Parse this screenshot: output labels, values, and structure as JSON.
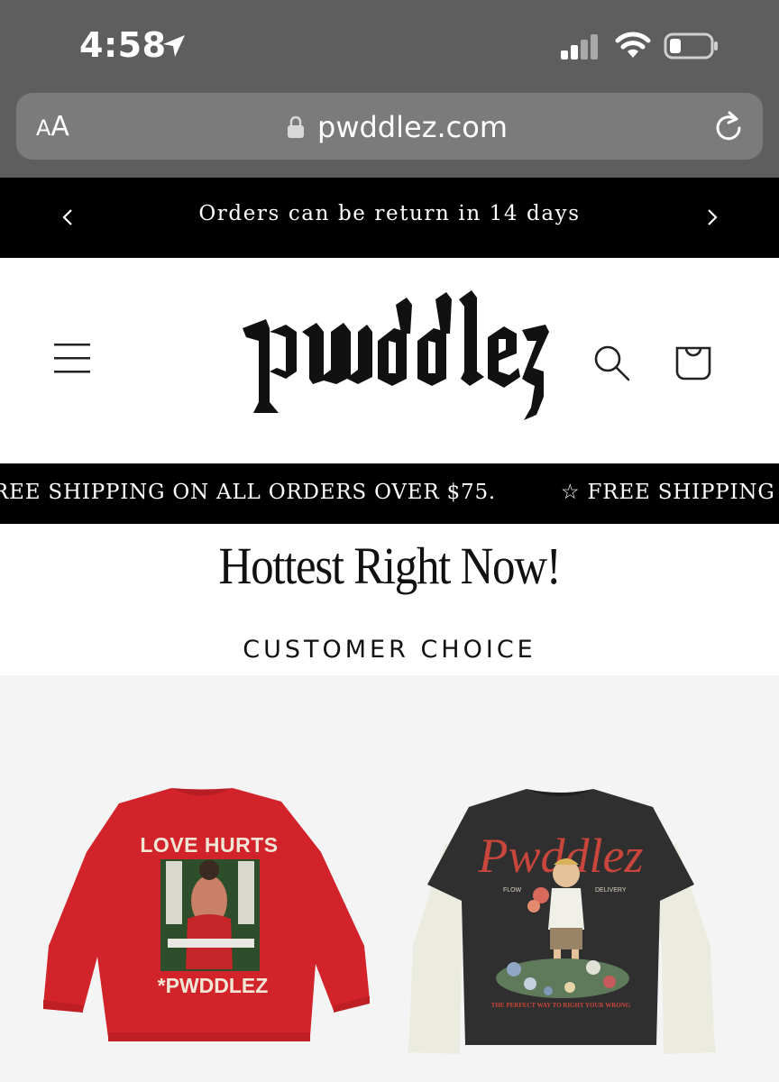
{
  "status_bar": {
    "time": "4:58"
  },
  "browser": {
    "text_size_small": "A",
    "text_size_big": "A",
    "url": "pwddlez.com"
  },
  "announcement": {
    "text": "Orders can be return in 14 days",
    "prev": "‹",
    "next": "›"
  },
  "header": {
    "logo_text": "pwddlez"
  },
  "marquee": {
    "items": [
      "REE SHIPPING ON ALL ORDERS OVER $75.",
      "☆ FREE SHIPPING ON"
    ]
  },
  "section": {
    "title": "Hottest Right Now!",
    "subtitle": "CUSTOMER CHOICE"
  },
  "products": [
    {
      "print_top": "LOVE HURTS",
      "print_bottom": "*PWDDLEZ",
      "color": "#d3232a"
    },
    {
      "print_top": "Pwddlez",
      "print_flow": "FLOW",
      "print_delivery": "DELIVERY",
      "print_bottom": "THE PERFECT WAY TO RIGHT YOUR WRONG",
      "color": "#2f2f2f"
    }
  ]
}
